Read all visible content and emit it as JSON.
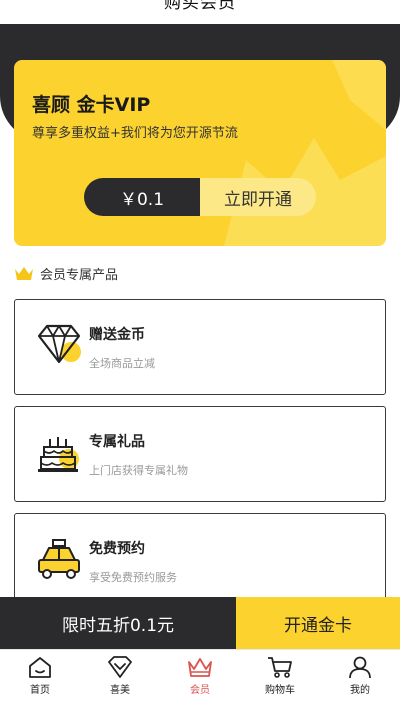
{
  "header": {
    "title": "购买会员"
  },
  "vip_card": {
    "title": "喜顾 金卡VIP",
    "subtitle": "尊享多重权益+我们将为您开源节流",
    "price": "￥0.1",
    "open_label": "立即开通"
  },
  "section": {
    "label": "会员专属产品"
  },
  "products": [
    {
      "title": "赠送金币",
      "desc": "全场商品立减",
      "icon": "diamond-icon"
    },
    {
      "title": "专属礼品",
      "desc": "上门店获得专属礼物",
      "icon": "cake-icon"
    },
    {
      "title": "免费预约",
      "desc": "享受免费预约服务",
      "icon": "taxi-icon"
    }
  ],
  "buy_bar": {
    "promo": "限时五折0.1元",
    "cta": "开通金卡"
  },
  "tabs": [
    {
      "label": "首页",
      "icon": "home-icon"
    },
    {
      "label": "喜美",
      "icon": "heart-gem-icon"
    },
    {
      "label": "会员",
      "icon": "crown-icon",
      "active": true
    },
    {
      "label": "购物车",
      "icon": "cart-icon"
    },
    {
      "label": "我的",
      "icon": "user-icon"
    }
  ],
  "colors": {
    "accent": "#fbd22e",
    "dark": "#2b2b2e",
    "active_tab": "#d9534f"
  }
}
